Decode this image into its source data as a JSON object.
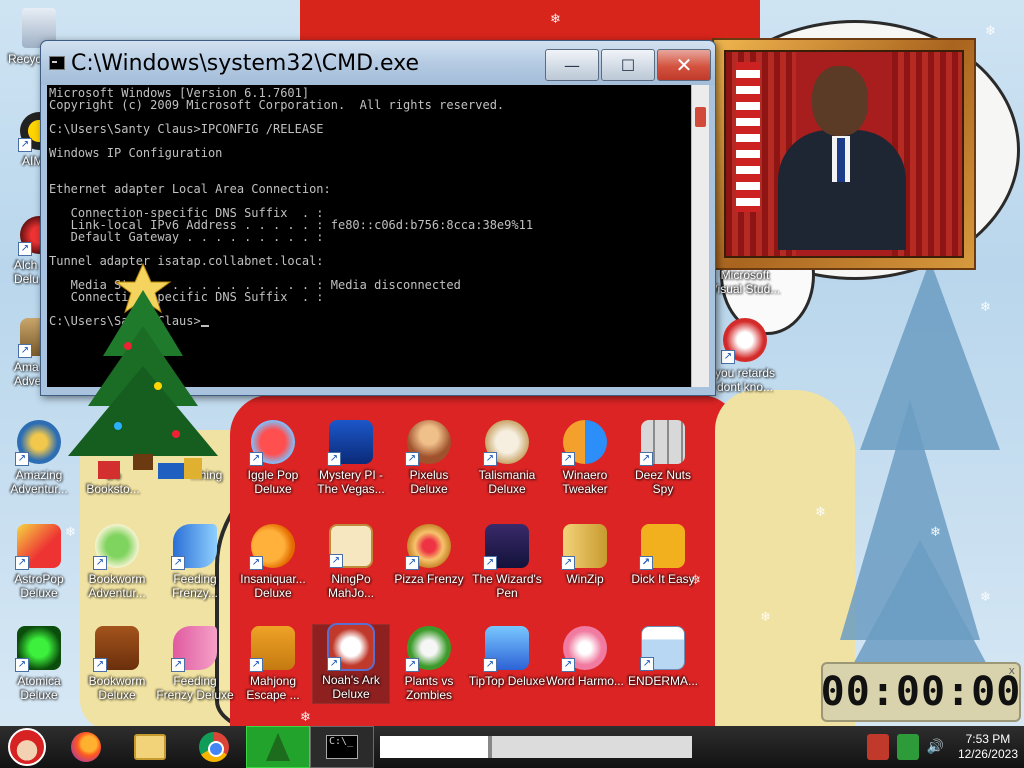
{
  "cmd": {
    "title": "C:\\Windows\\system32\\CMD.exe",
    "lines": [
      "Microsoft Windows [Version 6.1.7601]",
      "Copyright (c) 2009 Microsoft Corporation.  All rights reserved.",
      "",
      "C:\\Users\\Santy Claus>IPCONFIG /RELEASE",
      "",
      "Windows IP Configuration",
      "",
      "",
      "Ethernet adapter Local Area Connection:",
      "",
      "   Connection-specific DNS Suffix  . :",
      "   Link-local IPv6 Address . . . . . : fe80::c06d:b756:8cca:38e9%11",
      "   Default Gateway . . . . . . . . . :",
      "",
      "Tunnel adapter isatap.collabnet.local:",
      "",
      "   Media State . . . . . . . . . . . : Media disconnected",
      "   Connection-specific DNS Suffix  . :",
      "",
      "C:\\Users\\Santy Claus>"
    ],
    "buttons": {
      "minimize": "—",
      "maximize": "☐",
      "close": "✕"
    }
  },
  "desktop_icons": {
    "col1": [
      {
        "label": "Recycle Bin",
        "icon": "recycle-bin-icon"
      },
      {
        "label": "AIM",
        "icon": "aim-icon"
      },
      {
        "label": "Alchemy Deluxe",
        "icon": "alchemy-icon"
      },
      {
        "label": "Amazing Adventures",
        "icon": "amazing-adventures-icon"
      },
      {
        "label": "Amazing Adventur...",
        "icon": "compass-icon"
      },
      {
        "label": "AstroPop Deluxe",
        "icon": "astropop-icon"
      },
      {
        "label": "Atomica Deluxe",
        "icon": "atomica-icon"
      }
    ],
    "col1_visible": [
      "Recyc",
      "AIM",
      "Alch Delu",
      "Ama Adve"
    ],
    "row_top": [
      {
        "label": "Bookworm Adventur...",
        "icon": "bookworm-icon"
      },
      {
        "label": "Feeding Frenzy...",
        "icon": "feeding-frenzy-icon"
      },
      {
        "label": "Insaniquarium Deluxe",
        "icon": "insaniquarium-icon"
      }
    ],
    "row2": [
      {
        "label": "Bo Booksto...",
        "icon": "bookstore-icon"
      },
      {
        "label": "Iggle Pop Deluxe",
        "icon": "iggle-pop-icon"
      },
      {
        "label": "Mystery PI - The Vegas...",
        "icon": "mystery-pi-icon"
      },
      {
        "label": "Pixelus Deluxe",
        "icon": "pixelus-icon"
      },
      {
        "label": "Talismania Deluxe",
        "icon": "talismania-icon"
      },
      {
        "label": "Winaero Tweaker",
        "icon": "winaero-icon"
      },
      {
        "label": "Deez Nuts Spy",
        "icon": "windows-squares-icon"
      }
    ],
    "row3": [
      {
        "label": "AstroPop Deluxe",
        "icon": "astropop-icon"
      },
      {
        "label": "Bookworm Adventur...",
        "icon": "bookworm-icon"
      },
      {
        "label": "Feeding Frenzy...",
        "icon": "fish-icon"
      },
      {
        "label": "Insaniquar... Deluxe",
        "icon": "goldfish-icon"
      },
      {
        "label": "NingPo MahJo...",
        "icon": "ningpo-icon"
      },
      {
        "label": "Pizza Frenzy",
        "icon": "pizza-icon"
      },
      {
        "label": "The Wizard's Pen",
        "icon": "wizard-icon"
      },
      {
        "label": "WinZip",
        "icon": "winzip-icon"
      },
      {
        "label": "Dick It Easy",
        "icon": "de-icon"
      }
    ],
    "row4": [
      {
        "label": "Atomica Deluxe",
        "icon": "atomica-icon"
      },
      {
        "label": "Bookworm Deluxe",
        "icon": "bookworm-book-icon"
      },
      {
        "label": "Feeding Frenzy Deluxe",
        "icon": "fish-icon"
      },
      {
        "label": "Mahjong Escape ...",
        "icon": "mahjong-icon"
      },
      {
        "label": "Noah's Ark Deluxe",
        "icon": "dove-icon"
      },
      {
        "label": "Plants vs Zombies",
        "icon": "plant-icon"
      },
      {
        "label": "TipTop Deluxe",
        "icon": "cocktail-icon"
      },
      {
        "label": "Word Harmo...",
        "icon": "flower-icon"
      },
      {
        "label": "ENDERMA...",
        "icon": "window-app-icon"
      }
    ],
    "right_col": [
      {
        "label": "Microsoft Visual Stud...",
        "icon": "vs-icon"
      },
      {
        "label": "you retards dont kno...",
        "icon": "snake-icon"
      }
    ],
    "row2_extra": {
      "label": "...hing",
      "icon": "gifts-icon"
    }
  },
  "timer": {
    "value": "00:00:00",
    "close": "x"
  },
  "taskbar": {
    "time": "7:53 PM",
    "date": "12/26/2023",
    "speaker": "🔊",
    "cmd_preview": "C:\\_"
  },
  "colors": {
    "taskbar": "#1a1a1a",
    "cmd_bg": "#000000",
    "cmd_text": "#c0c0c0",
    "window_chrome": "#b5cbe3",
    "close_button": "#c0392b"
  }
}
